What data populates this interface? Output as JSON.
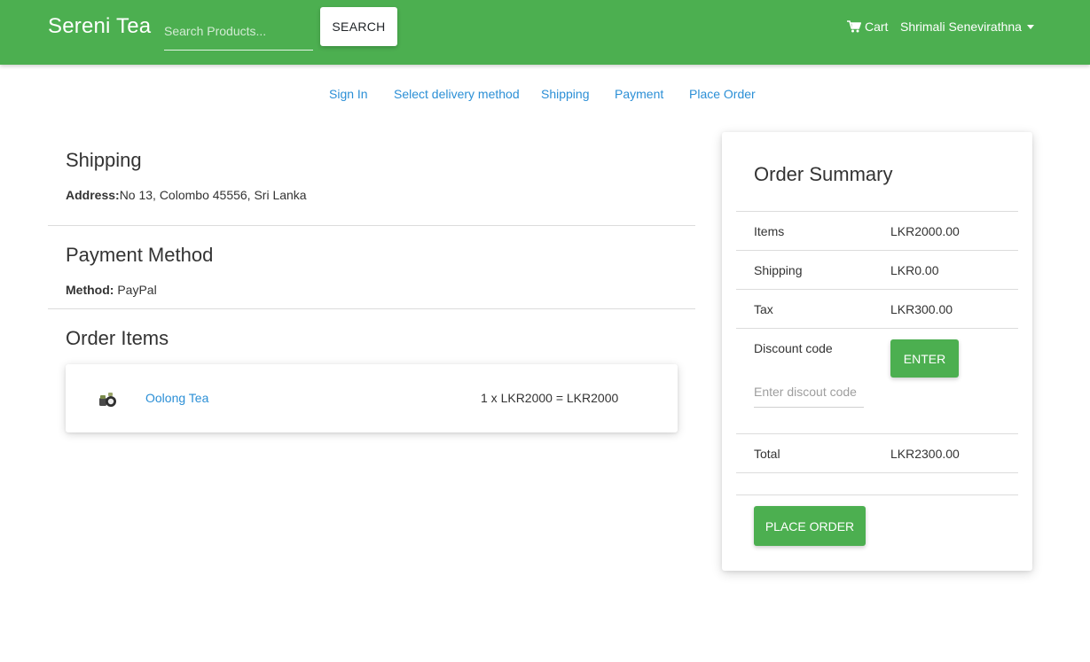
{
  "navbar": {
    "brand": "Sereni Tea",
    "search_placeholder": "Search Products...",
    "search_button": "SEARCH",
    "cart_label": "Cart",
    "cart_icon": "shopping-cart-icon",
    "user_name": "Shrimali Senevirathna",
    "user_icon": "caret-down-icon",
    "background_color": "#4caf50"
  },
  "steps": [
    {
      "label": "Sign In"
    },
    {
      "label": "Select delivery method"
    },
    {
      "label": "Shipping"
    },
    {
      "label": "Payment"
    },
    {
      "label": "Place Order"
    }
  ],
  "shipping": {
    "title": "Shipping",
    "address_label": "Address:",
    "address_value": "No 13, Colombo 45556, Sri Lanka"
  },
  "payment": {
    "title": "Payment Method",
    "method_label": "Method:",
    "method_value": "PayPal"
  },
  "order_items": {
    "title": "Order Items",
    "items": [
      {
        "name": "Oolong Tea",
        "price_line": "1 x LKR2000 = LKR2000",
        "thumbnail_icon": "tea-product-thumbnail"
      }
    ]
  },
  "summary": {
    "title": "Order Summary",
    "items_label": "Items",
    "items_value": "LKR2000.00",
    "shipping_label": "Shipping",
    "shipping_value": "LKR0.00",
    "tax_label": "Tax",
    "tax_value": "LKR300.00",
    "discount_label": "Discount code",
    "discount_placeholder": "Enter discout code",
    "enter_button": "ENTER",
    "total_label": "Total",
    "total_value": "LKR2300.00",
    "place_order_button": "PLACE ORDER"
  },
  "colors": {
    "accent": "#4caf50",
    "link": "#2b8fd6"
  }
}
